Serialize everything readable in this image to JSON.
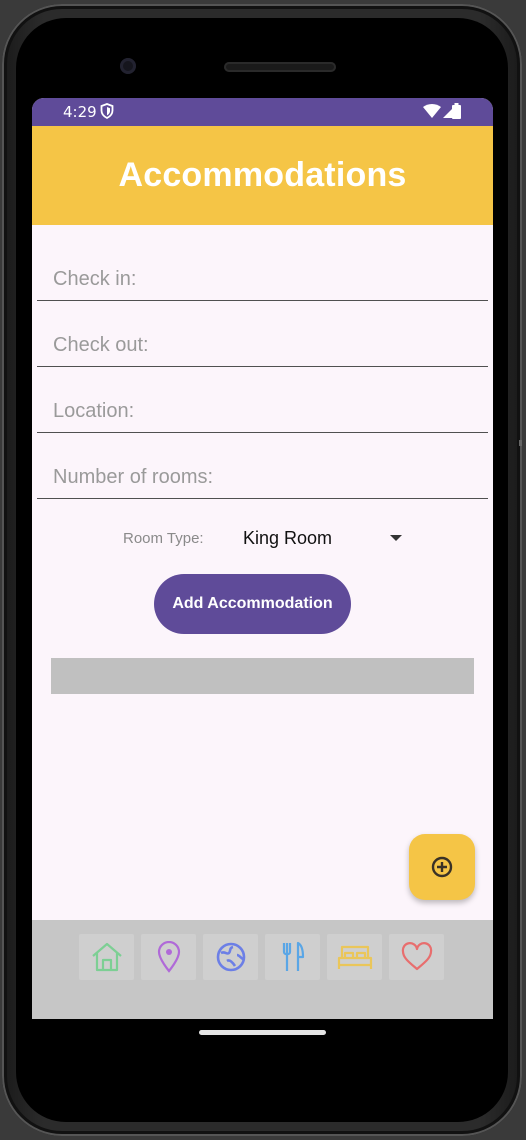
{
  "status_bar": {
    "time": "4:29"
  },
  "app_bar": {
    "title": "Accommodations"
  },
  "form": {
    "check_in": {
      "placeholder": "Check in:",
      "value": ""
    },
    "check_out": {
      "placeholder": "Check out:",
      "value": ""
    },
    "location": {
      "placeholder": "Location:",
      "value": ""
    },
    "rooms": {
      "placeholder": "Number of rooms:",
      "value": ""
    },
    "room_type_label": "Room Type:",
    "room_type_value": "King Room",
    "add_button_label": "Add Accommodation"
  },
  "fab": {
    "icon": "add-circle-icon"
  },
  "bottom_nav": {
    "items": [
      {
        "icon": "home-icon",
        "color": "#7dcf94"
      },
      {
        "icon": "location-pin-icon",
        "color": "#b06ad8"
      },
      {
        "icon": "globe-icon",
        "color": "#6c7fe6"
      },
      {
        "icon": "fork-knife-icon",
        "color": "#5aa6e6"
      },
      {
        "icon": "bed-icon",
        "color": "#eac65a"
      },
      {
        "icon": "heart-icon",
        "color": "#e86e6e"
      }
    ]
  },
  "colors": {
    "primary": "#5f4b99",
    "accent": "#f5c546",
    "background": "#fcf5fb"
  }
}
